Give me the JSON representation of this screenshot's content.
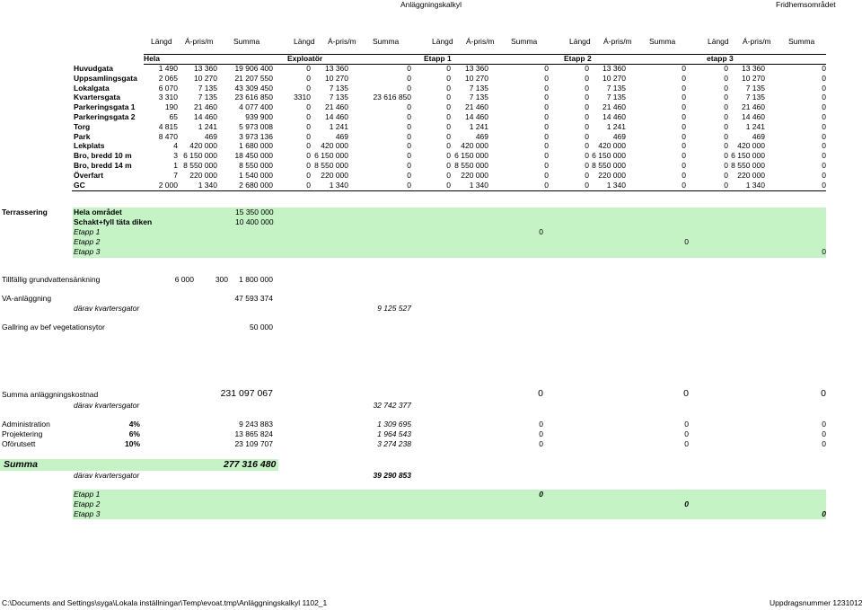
{
  "header": {
    "title": "Anläggningskalkyl",
    "right": "Fridhemsområdet"
  },
  "col_headers": [
    "Längd",
    "Á-pris/m",
    "Summa",
    "Längd",
    "Á-pris/m",
    "Summa",
    "Längd",
    "Á-pris/m",
    "Summa",
    "Längd",
    "Á-pris/m",
    "Summa",
    "Längd",
    "Á-pris/m",
    "Summa"
  ],
  "group_headers": [
    "Hela",
    "Exploatör",
    "Etapp 1",
    "Etapp 2",
    "etapp 3"
  ],
  "rows": [
    {
      "name": "Huvudgata",
      "vals": [
        "1 490",
        "13 360",
        "19 906 400",
        "0",
        "13 360",
        "0",
        "0",
        "13 360",
        "0",
        "0",
        "13 360",
        "0",
        "0",
        "13 360",
        "0"
      ]
    },
    {
      "name": "Uppsamlingsgata",
      "vals": [
        "2 065",
        "10 270",
        "21 207 550",
        "0",
        "10 270",
        "0",
        "0",
        "10 270",
        "0",
        "0",
        "10 270",
        "0",
        "0",
        "10 270",
        "0"
      ]
    },
    {
      "name": "Lokalgata",
      "vals": [
        "6 070",
        "7 135",
        "43 309 450",
        "0",
        "7 135",
        "0",
        "0",
        "7 135",
        "0",
        "0",
        "7 135",
        "0",
        "0",
        "7 135",
        "0"
      ]
    },
    {
      "name": "Kvartersgata",
      "vals": [
        "3 310",
        "7 135",
        "23 616 850",
        "3310",
        "7 135",
        "23 616 850",
        "0",
        "7 135",
        "0",
        "0",
        "7 135",
        "0",
        "0",
        "7 135",
        "0"
      ]
    },
    {
      "name": "Parkeringsgata 1",
      "vals": [
        "190",
        "21 460",
        "4 077 400",
        "0",
        "21 460",
        "0",
        "0",
        "21 460",
        "0",
        "0",
        "21 460",
        "0",
        "0",
        "21 460",
        "0"
      ]
    },
    {
      "name": "Parkeringsgata 2",
      "vals": [
        "65",
        "14 460",
        "939 900",
        "0",
        "14 460",
        "0",
        "0",
        "14 460",
        "0",
        "0",
        "14 460",
        "0",
        "0",
        "14 460",
        "0"
      ]
    },
    {
      "name": "Torg",
      "vals": [
        "4 815",
        "1 241",
        "5 973 008",
        "0",
        "1 241",
        "0",
        "0",
        "1 241",
        "0",
        "0",
        "1 241",
        "0",
        "0",
        "1 241",
        "0"
      ]
    },
    {
      "name": "Park",
      "vals": [
        "8 470",
        "469",
        "3 973 136",
        "0",
        "469",
        "0",
        "0",
        "469",
        "0",
        "0",
        "469",
        "0",
        "0",
        "469",
        "0"
      ]
    },
    {
      "name": "Lekplats",
      "vals": [
        "4",
        "420 000",
        "1 680 000",
        "0",
        "420 000",
        "0",
        "0",
        "420 000",
        "0",
        "0",
        "420 000",
        "0",
        "0",
        "420 000",
        "0"
      ]
    },
    {
      "name": "Bro, bredd 10 m",
      "vals": [
        "3",
        "6 150 000",
        "18 450 000",
        "0",
        "6 150 000",
        "0",
        "0",
        "6 150 000",
        "0",
        "0",
        "6 150 000",
        "0",
        "0",
        "6 150 000",
        "0"
      ]
    },
    {
      "name": "Bro, bredd 14 m",
      "vals": [
        "1",
        "8 550 000",
        "8 550 000",
        "0",
        "8 550 000",
        "0",
        "0",
        "8 550 000",
        "0",
        "0",
        "8 550 000",
        "0",
        "0",
        "8 550 000",
        "0"
      ]
    },
    {
      "name": "Överfart",
      "vals": [
        "7",
        "220 000",
        "1 540 000",
        "0",
        "220 000",
        "0",
        "0",
        "220 000",
        "0",
        "0",
        "220 000",
        "0",
        "0",
        "220 000",
        "0"
      ]
    },
    {
      "name": "GC",
      "vals": [
        "2 000",
        "1 340",
        "2 680 000",
        "0",
        "1 340",
        "0",
        "0",
        "1 340",
        "0",
        "0",
        "1 340",
        "0",
        "0",
        "1 340",
        "0"
      ]
    }
  ],
  "terrassering": {
    "label": "Terrassering",
    "hela_label": "Hela området",
    "hela_value": "15 350 000",
    "schakt_label": "Schakt+fyll täta diken",
    "schakt_value": "10 400 000",
    "etapp1_label": "Etapp 1",
    "etapp1_value": "0",
    "etapp2_label": "Etapp 2",
    "etapp2_value": "0",
    "etapp3_label": "Etapp 3",
    "etapp3_value": "0"
  },
  "grundvatten": {
    "label": "Tillfällig grundvattensänkning",
    "langd": "6 000",
    "apris": "300",
    "summa": "1 800 000"
  },
  "va": {
    "label": "VA-anläggning",
    "value": "47 593 374",
    "sub_label": "därav kvartersgator",
    "sub_value": "9 125 527"
  },
  "gallring": {
    "label": "Gallring av bef vegetationsytor",
    "value": "50 000"
  },
  "summa_anl": {
    "label": "Summa anläggningskostnad",
    "value": "231 097 067",
    "e1": "0",
    "e2": "0",
    "e3": "0",
    "sub_label": "därav kvartersgator",
    "sub_value": "32 742 377"
  },
  "admin": {
    "label": "Administration",
    "pct": "4%",
    "value": "9 243 883",
    "expl": "1 309 695",
    "e1": "0",
    "e2": "0",
    "e3": "0"
  },
  "projekt": {
    "label": "Projektering",
    "pct": "6%",
    "value": "13 865 824",
    "expl": "1 964 543",
    "e1": "0",
    "e2": "0",
    "e3": "0"
  },
  "oforutsett": {
    "label": "Oförutsett",
    "pct": "10%",
    "value": "23 109 707",
    "expl": "3 274 238",
    "e1": "0",
    "e2": "0",
    "e3": "0"
  },
  "summa": {
    "label": "Summa",
    "value": "277 316 480",
    "sub_label": "därav kvartersgator",
    "sub_value": "39 290 853"
  },
  "final_etapp": {
    "etapp1_label": "Etapp 1",
    "etapp1_value": "0",
    "etapp2_label": "Etapp 2",
    "etapp2_value": "0",
    "etapp3_label": "Etapp 3",
    "etapp3_value": "0"
  },
  "footer": {
    "path": "C:\\Documents and Settings\\syga\\Lokala inställningar\\Temp\\evoat.tmp\\Anläggningskalkyl 1102_1",
    "right": "Uppdragsnummer 1231012"
  },
  "colors": {
    "green": "#c6f3c6"
  }
}
